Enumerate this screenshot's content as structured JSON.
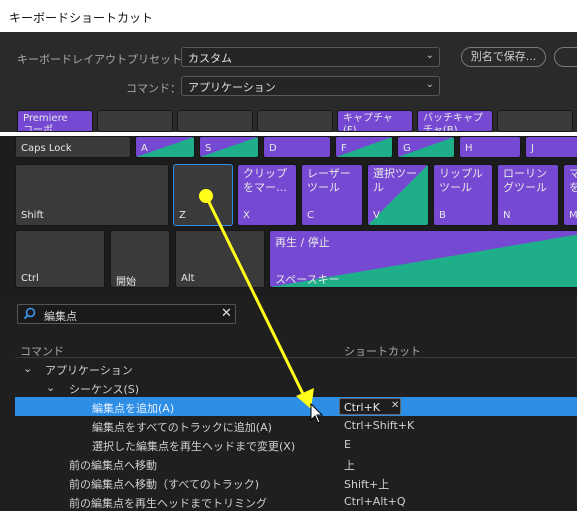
{
  "window": {
    "title": "キーボードショートカット"
  },
  "settings": {
    "layout_label": "キーボードレイアウトプリセット：",
    "layout_value": "カスタム",
    "save_as_label": "別名で保存...",
    "command_label": "コマンド：",
    "command_value": "アプリケーション"
  },
  "top_keys": [
    {
      "label": "Premiere\nコーポ"
    },
    {
      "label": ""
    },
    {
      "label": ""
    },
    {
      "label": ""
    },
    {
      "label": "キャプチャ\n(F)"
    },
    {
      "label": "バッチキャプ\nチャ(B)"
    },
    {
      "label": ""
    }
  ],
  "row_a": [
    {
      "label": "Caps Lock"
    },
    {
      "label": "A"
    },
    {
      "label": "S"
    },
    {
      "label": "D"
    },
    {
      "label": "F"
    },
    {
      "label": "G"
    },
    {
      "label": "H"
    },
    {
      "label": "J"
    }
  ],
  "row_z": [
    {
      "label": "Shift",
      "name": ""
    },
    {
      "label": "Z",
      "name": ""
    },
    {
      "label": "X",
      "name": "クリップ\nをマー…"
    },
    {
      "label": "C",
      "name": "レーザー\nツール"
    },
    {
      "label": "V",
      "name": "選択ツー\nル"
    },
    {
      "label": "B",
      "name": "リップル\nツール"
    },
    {
      "label": "N",
      "name": "ローリン\nグツール"
    },
    {
      "label": "M",
      "name": "マ\nを"
    }
  ],
  "row_space": [
    {
      "label": "Ctrl"
    },
    {
      "label": "開始"
    },
    {
      "label": "Alt"
    },
    {
      "label": "スペースキー",
      "name": "再生 / 停止"
    }
  ],
  "search": {
    "value": "編集点"
  },
  "table": {
    "col_command": "コマンド",
    "col_shortcut": "ショートカット",
    "rows": [
      {
        "command": "アプリケーション",
        "shortcut": ""
      },
      {
        "command": "シーケンス(S)",
        "shortcut": ""
      },
      {
        "command": "編集点を追加(A)",
        "shortcut": "Ctrl+K"
      },
      {
        "command": "編集点をすべてのトラックに追加(A)",
        "shortcut": "Ctrl+Shift+K"
      },
      {
        "command": "選択した編集点を再生ヘッドまで変更(X)",
        "shortcut": "E"
      },
      {
        "command": "前の編集点へ移動",
        "shortcut": "上"
      },
      {
        "command": "前の編集点へ移動（すべてのトラック)",
        "shortcut": "Shift+上"
      },
      {
        "command": "前の編集点を再生ヘッドまでトリミング",
        "shortcut": "Ctrl+Alt+Q"
      }
    ]
  },
  "colors": {
    "accent": "#7549d2",
    "teal": "#1eae8a",
    "selection": "#2d8ee6",
    "arrow": "#ffff1a"
  }
}
